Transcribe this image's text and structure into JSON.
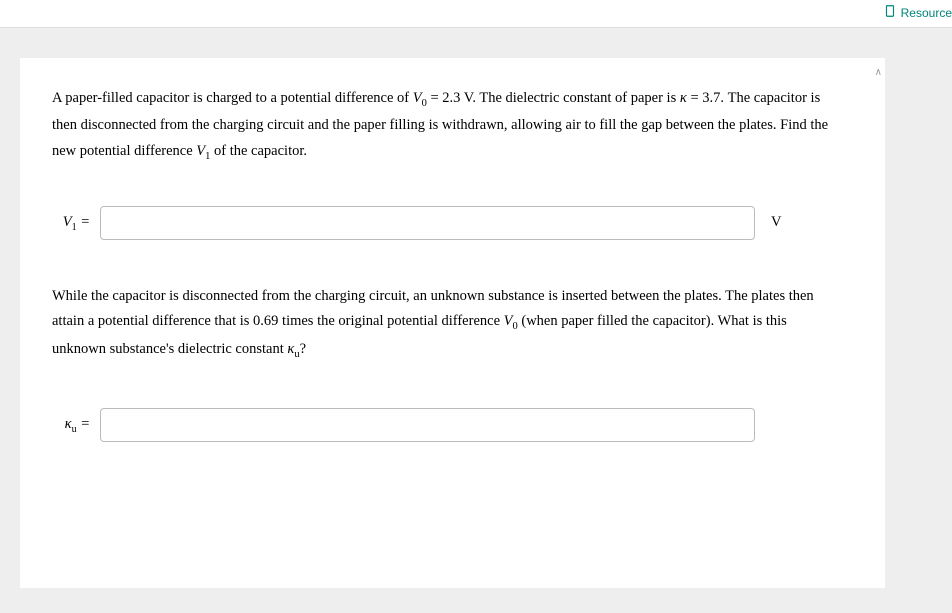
{
  "header": {
    "resource_label": "Resource"
  },
  "problem": {
    "p1_part1": "A paper-filled capacitor is charged to a potential difference of ",
    "p1_v0": "V",
    "p1_v0_sub": "0",
    "p1_part2": " = 2.3 V. The dielectric constant of paper is ",
    "p1_kappa": "κ",
    "p1_part3": " = 3.7. The capacitor is then disconnected from the charging circuit and the paper filling is withdrawn, allowing air to fill the gap between the plates. Find the new potential difference ",
    "p1_v1": "V",
    "p1_v1_sub": "1",
    "p1_part4": " of the capacitor.",
    "answer1_label_sym": "V",
    "answer1_label_sub": "1",
    "answer1_eq": " =",
    "answer1_unit": "V",
    "p2_part1": "While the capacitor is disconnected from the charging circuit, an unknown substance is inserted between the plates. The plates then attain a potential difference that is 0.69 times the original potential difference ",
    "p2_v0": "V",
    "p2_v0_sub": "0",
    "p2_part2": " (when paper filled the capacitor). What is this unknown substance's dielectric constant ",
    "p2_ku": "κ",
    "p2_ku_sub": "u",
    "p2_part3": "?",
    "answer2_label_sym": "κ",
    "answer2_label_sub": "u",
    "answer2_eq": " ="
  }
}
